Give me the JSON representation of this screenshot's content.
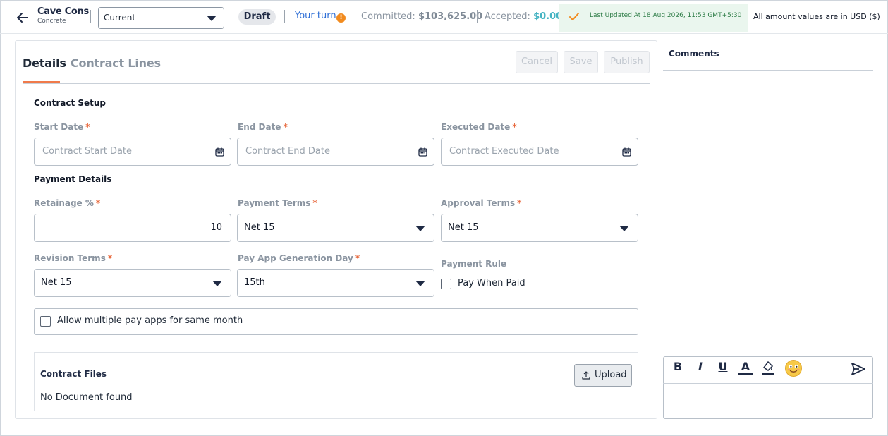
{
  "header": {
    "title": "Cave Cons",
    "subtitle": "Concrete",
    "view_select": "Current",
    "status": "Draft",
    "your_turn": "Your turn",
    "info_badge": "!",
    "committed_label": "Committed:",
    "committed_value": "$103,625.00",
    "accepted_label": "Accepted:",
    "accepted_value": "$0.00",
    "last_updated": "Last Updated At 18 Aug 2026, 11:53 GMT+5:30",
    "currency_note": "All amount values are in USD ($)",
    "separator": "|"
  },
  "tabs": {
    "details": "Details",
    "contract_lines": "Contract Lines"
  },
  "actions": {
    "cancel": "Cancel",
    "save": "Save",
    "publish": "Publish"
  },
  "contract_setup": {
    "title": "Contract Setup",
    "start_label": "Start Date",
    "start_placeholder": "Contract Start Date",
    "end_label": "End Date",
    "end_placeholder": "Contract End Date",
    "executed_label": "Executed Date",
    "executed_placeholder": "Contract Executed Date"
  },
  "payment": {
    "title": "Payment Details",
    "retainage_label": "Retainage %",
    "retainage_value": "10",
    "payment_terms_label": "Payment Terms",
    "payment_terms_value": "Net 15",
    "approval_terms_label": "Approval Terms",
    "approval_terms_value": "Net 15",
    "revision_terms_label": "Revision Terms",
    "revision_terms_value": "Net 15",
    "pay_app_day_label": "Pay App Generation Day",
    "pay_app_day_value": "15th",
    "payment_rule_label": "Payment Rule",
    "pay_when_paid": "Pay When Paid",
    "allow_multiple": "Allow multiple pay apps for same month",
    "required_mark": "*"
  },
  "files": {
    "title": "Contract Files",
    "upload": "Upload",
    "empty": "No Document found"
  },
  "comments": {
    "title": "Comments",
    "toolbar": [
      "B",
      "I",
      "U",
      "A"
    ]
  },
  "colors": {
    "accent_tab": "#f07a4a",
    "link_blue": "#2f6fd6",
    "accepted_teal": "#44b3c2",
    "updated_bg": "#eaf6ee"
  }
}
